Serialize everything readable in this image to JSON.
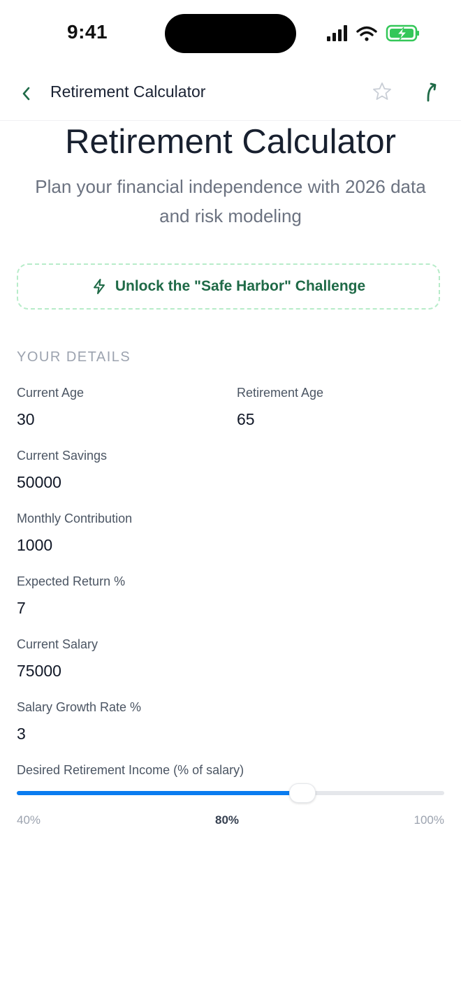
{
  "status_bar": {
    "time": "9:41",
    "icons": [
      "cellular-signal-icon",
      "wifi-icon",
      "battery-charging-icon"
    ],
    "battery_color": "#34c759"
  },
  "nav": {
    "back_icon": "chevron-left-icon",
    "title": "Retirement Calculator",
    "star_icon": "star-outline-icon",
    "share_icon": "share-arrow-icon",
    "accent": "#1f6a47"
  },
  "hero": {
    "title": "Retirement Calculator",
    "subtitle": "Plan your financial independence with 2026 data and risk modeling"
  },
  "challenge": {
    "icon": "lightning-bolt-icon",
    "label": "Unlock the \"Safe Harbor\" Challenge",
    "border_color": "#b7ecc9"
  },
  "details": {
    "header": "YOUR DETAILS",
    "fields": {
      "current_age": {
        "label": "Current Age",
        "value": "30"
      },
      "retirement_age": {
        "label": "Retirement Age",
        "value": "65"
      },
      "current_savings": {
        "label": "Current Savings",
        "value": "50000"
      },
      "monthly_contribution": {
        "label": "Monthly Contribution",
        "value": "1000"
      },
      "expected_return": {
        "label": "Expected Return %",
        "value": "7"
      },
      "current_salary": {
        "label": "Current Salary",
        "value": "75000"
      },
      "salary_growth": {
        "label": "Salary Growth Rate %",
        "value": "3"
      }
    }
  },
  "income_slider": {
    "label": "Desired Retirement Income (% of salary)",
    "min_label": "40%",
    "current_label": "80%",
    "max_label": "100%",
    "min": 40,
    "max": 100,
    "value": 80,
    "fill_color": "#0a7cf0"
  }
}
